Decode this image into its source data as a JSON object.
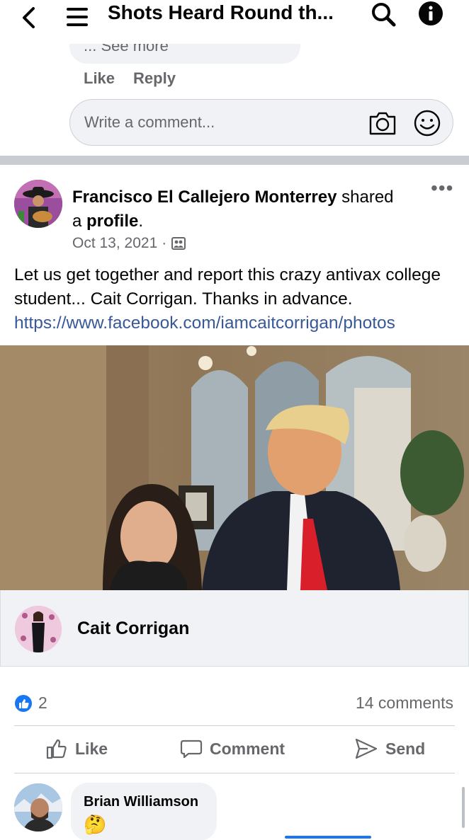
{
  "header": {
    "title": "Shots Heard Round th...",
    "icons": [
      "back-chevron-icon",
      "menu-icon",
      "search-icon",
      "info-icon"
    ]
  },
  "previous_comment": {
    "see_more": "... See more",
    "like": "Like",
    "reply": "Reply"
  },
  "comment_input": {
    "placeholder": "Write a comment..."
  },
  "post": {
    "author": "Francisco El Callejero Monterrey",
    "shared_text": " shared",
    "a_text": "a ",
    "profile_word": "profile",
    "period": ".",
    "date": "Oct 13, 2021",
    "dot": "·",
    "more": "•••",
    "body": "Let us get together and report this crazy antivax college student... Cait Corrigan. Thanks in advance.",
    "link": "https://www.facebook.com/iamcaitcorrigan/photos"
  },
  "shared_profile": {
    "name": "Cait Corrigan"
  },
  "stats": {
    "likes": "2",
    "comments": "14 comments"
  },
  "actions": {
    "like": "Like",
    "comment": "Comment",
    "send": "Send"
  },
  "comment": {
    "author": "Brian Williamson",
    "emoji": "🤔"
  },
  "colors": {
    "accent": "#1877f2",
    "link": "#385898",
    "secondary_text": "#65676b",
    "bubble": "#f0f2f5"
  }
}
